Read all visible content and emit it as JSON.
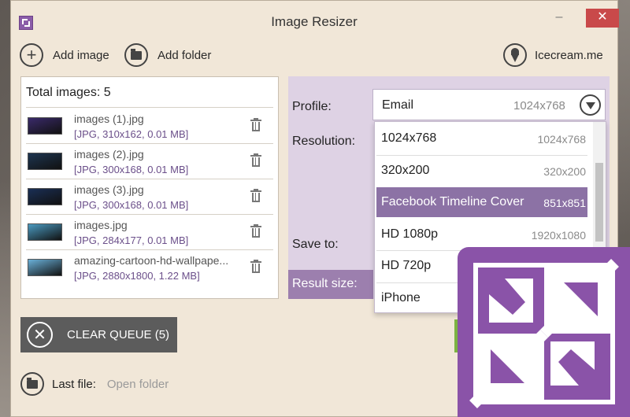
{
  "window": {
    "title": "Image Resizer",
    "minimize_glyph": "–",
    "close_glyph": "✕"
  },
  "toolbar": {
    "add_image": "Add image",
    "add_image_glyph": "+",
    "add_folder": "Add folder",
    "brand_link": "Icecream.me"
  },
  "list": {
    "total_label": "Total images: 5",
    "items": [
      {
        "name": "images (1).jpg",
        "meta": "[JPG, 310x162, 0.01 MB]",
        "thumb_color": "#3a2a6a"
      },
      {
        "name": "images (2).jpg",
        "meta": "[JPG, 300x168, 0.01 MB]",
        "thumb_color": "#1d3550"
      },
      {
        "name": "images (3).jpg",
        "meta": "[JPG, 300x168, 0.01 MB]",
        "thumb_color": "#1a2f55"
      },
      {
        "name": "images.jpg",
        "meta": "[JPG, 284x177, 0.01 MB]",
        "thumb_color": "#4a9ac0"
      },
      {
        "name": "amazing-cartoon-hd-wallpape...",
        "meta": "[JPG, 2880x1800, 1.22 MB]",
        "thumb_color": "#6ab0d8"
      }
    ]
  },
  "settings": {
    "profile_label": "Profile:",
    "resolution_label": "Resolution:",
    "save_to_label": "Save to:",
    "result_size_label": "Result size:",
    "profile_value": "Email",
    "profile_resolution": "1024x768",
    "dropdown_options": [
      {
        "label": "1024x768",
        "res": "1024x768",
        "selected": false
      },
      {
        "label": "320x200",
        "res": "320x200",
        "selected": false
      },
      {
        "label": "Facebook Timeline Cover",
        "res": "851x851",
        "selected": true
      },
      {
        "label": "HD 1080p",
        "res": "1920x1080",
        "selected": false
      },
      {
        "label": "HD 720p",
        "res": "",
        "selected": false
      },
      {
        "label": "iPhone",
        "res": "",
        "selected": false
      }
    ]
  },
  "queue": {
    "clear_label": "CLEAR QUEUE (5)",
    "clear_glyph": "✕"
  },
  "footer": {
    "last_file_label": "Last file:",
    "open_folder": "Open folder"
  },
  "colors": {
    "accent": "#8a53a8",
    "selected_option": "#8c72a5",
    "window_bg": "#f1e7d8"
  }
}
